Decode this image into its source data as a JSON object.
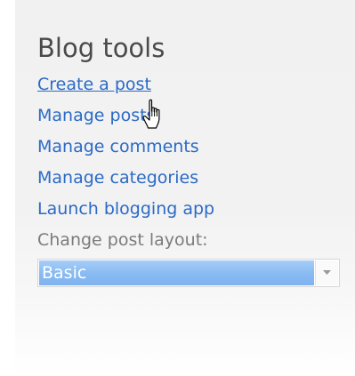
{
  "blog_tools": {
    "title": "Blog tools",
    "links": [
      {
        "label": "Create a post"
      },
      {
        "label": "Manage posts"
      },
      {
        "label": "Manage comments"
      },
      {
        "label": "Manage categories"
      },
      {
        "label": "Launch blogging app"
      }
    ],
    "layout_label": "Change post layout:",
    "layout_select": {
      "selected": "Basic"
    }
  },
  "cursor": {
    "icon": "hand-pointer-icon"
  },
  "colors": {
    "link": "#2a6ac6",
    "title": "#4a4a4a",
    "label": "#7b7b7b",
    "selected_bg": "#8abcf2"
  }
}
